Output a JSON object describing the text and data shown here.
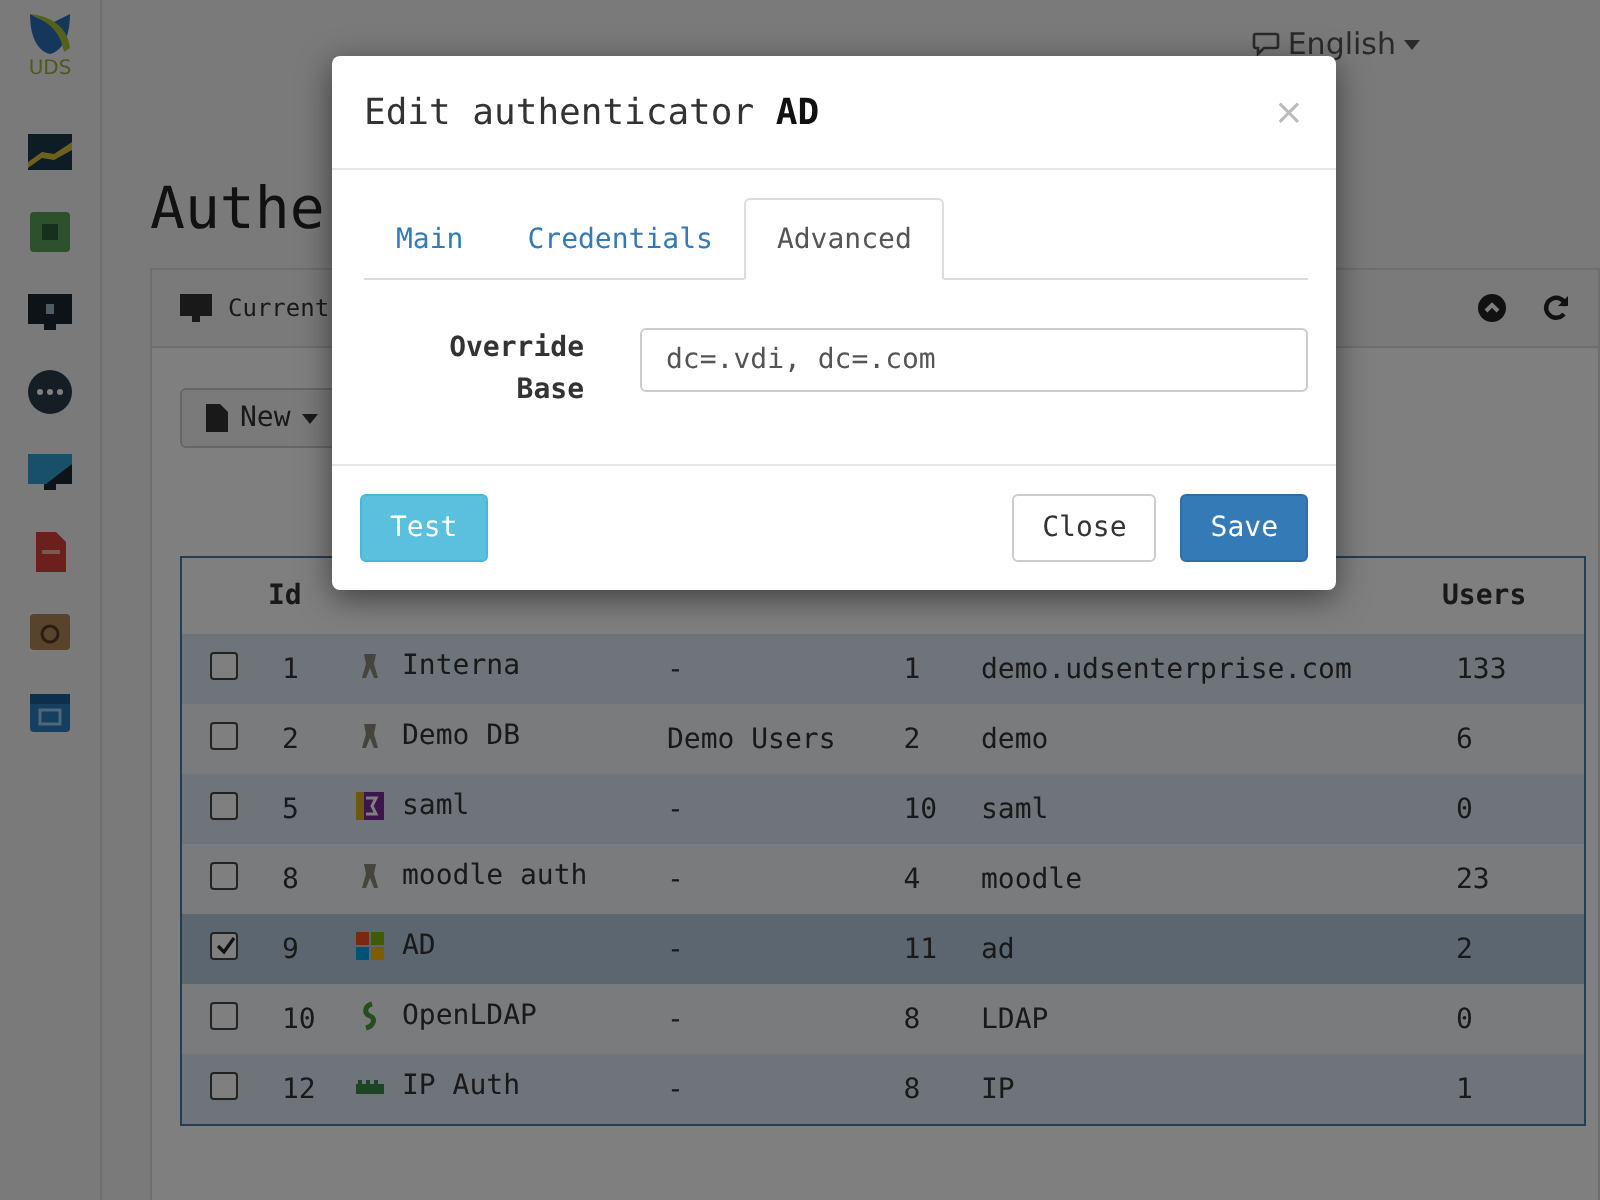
{
  "logo": {
    "text": "UDS"
  },
  "topbar": {
    "language": "English"
  },
  "page": {
    "title": "Authe"
  },
  "panel": {
    "title": "Current"
  },
  "toolbar": {
    "new_button": "New"
  },
  "table": {
    "columns": [
      {
        "label": "Id"
      },
      {
        "label": "Users"
      }
    ],
    "rows": [
      {
        "checked": false,
        "id": "1",
        "kind": "internal",
        "name": "Interna",
        "column_3": "-",
        "column_4": "1",
        "column_5": "demo.udsenterprise.com",
        "users": "133"
      },
      {
        "checked": false,
        "id": "2",
        "kind": "internal",
        "name": "Demo DB",
        "column_3": "Demo Users",
        "column_4": "2",
        "column_5": "demo",
        "users": "6"
      },
      {
        "checked": false,
        "id": "5",
        "kind": "saml",
        "name": "saml",
        "column_3": "-",
        "column_4": "10",
        "column_5": "saml",
        "users": "0"
      },
      {
        "checked": false,
        "id": "8",
        "kind": "internal",
        "name": "moodle auth",
        "column_3": "-",
        "column_4": "4",
        "column_5": "moodle",
        "users": "23"
      },
      {
        "checked": true,
        "id": "9",
        "kind": "windows",
        "name": "AD",
        "column_3": "-",
        "column_4": "11",
        "column_5": "ad",
        "users": "2"
      },
      {
        "checked": false,
        "id": "10",
        "kind": "ldap",
        "name": "OpenLDAP",
        "column_3": "-",
        "column_4": "8",
        "column_5": "LDAP",
        "users": "0"
      },
      {
        "checked": false,
        "id": "12",
        "kind": "ip",
        "name": "IP Auth",
        "column_3": "-",
        "column_4": "8",
        "column_5": "IP",
        "users": "1"
      }
    ]
  },
  "dialog": {
    "title": "Edit authenticator **AD**",
    "close": "×",
    "tabs": [
      {
        "label": "Main",
        "selected": false
      },
      {
        "label": "Credentials",
        "selected": false
      },
      {
        "label": "Advanced",
        "selected": true
      }
    ],
    "fields": [
      {
        "label": "Override Base",
        "value": "dc=.vdi, dc=.com"
      }
    ],
    "buttons": {
      "test": "Test",
      "close": "Close",
      "save": "Save"
    }
  }
}
